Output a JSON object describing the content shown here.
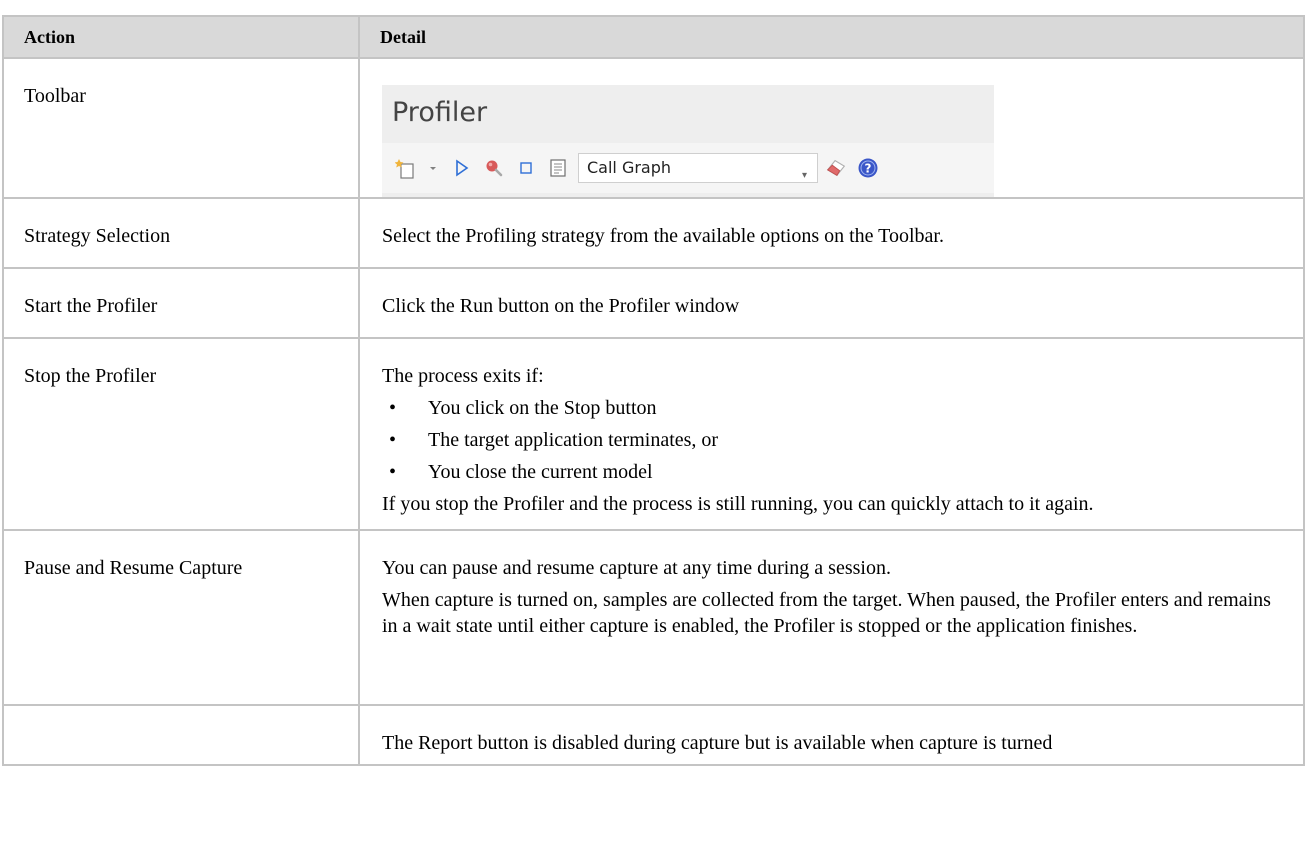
{
  "table": {
    "headers": {
      "action": "Action",
      "detail": "Detail"
    },
    "rows": [
      {
        "action": "Toolbar",
        "toolbar_image": {
          "title": "Profiler",
          "strategy_value": "Call Graph",
          "icons": [
            "new-document-icon",
            "dropdown-arrow-icon",
            "run-icon",
            "search-icon",
            "stop-icon",
            "report-icon",
            "combo-caret-icon",
            "eraser-icon",
            "help-icon"
          ]
        }
      },
      {
        "action": "Strategy Selection",
        "detail": "Select the Profiling strategy from the available options on the Toolbar."
      },
      {
        "action": "Start the Profiler",
        "detail": "Click the Run button on the Profiler window"
      },
      {
        "action": "Stop the Profiler",
        "intro": "The process exits if:",
        "bullets": [
          "You click on the Stop button",
          "The target application terminates, or",
          "You close the current model"
        ],
        "outro": "If you stop the Profiler and the process is still running, you can quickly attach to it again."
      },
      {
        "action": "Pause and Resume Capture",
        "paragraphs": [
          "You can pause and resume capture at any time during a session.",
          "When capture is turned on, samples are collected from the target. When paused, the Profiler enters and remains in a wait state until either capture is enabled, the Profiler is stopped or the application finishes."
        ]
      },
      {
        "action": "",
        "detail": "The Report button is disabled during capture but is available when capture is turned"
      }
    ]
  },
  "bullet_glyph": "•",
  "colors": {
    "header_bg": "#d9d9d9",
    "border": "#c4c4c4",
    "run_blue": "#2f6fd6",
    "search_red": "#c83a3a",
    "help_blue": "#3a56c8"
  }
}
